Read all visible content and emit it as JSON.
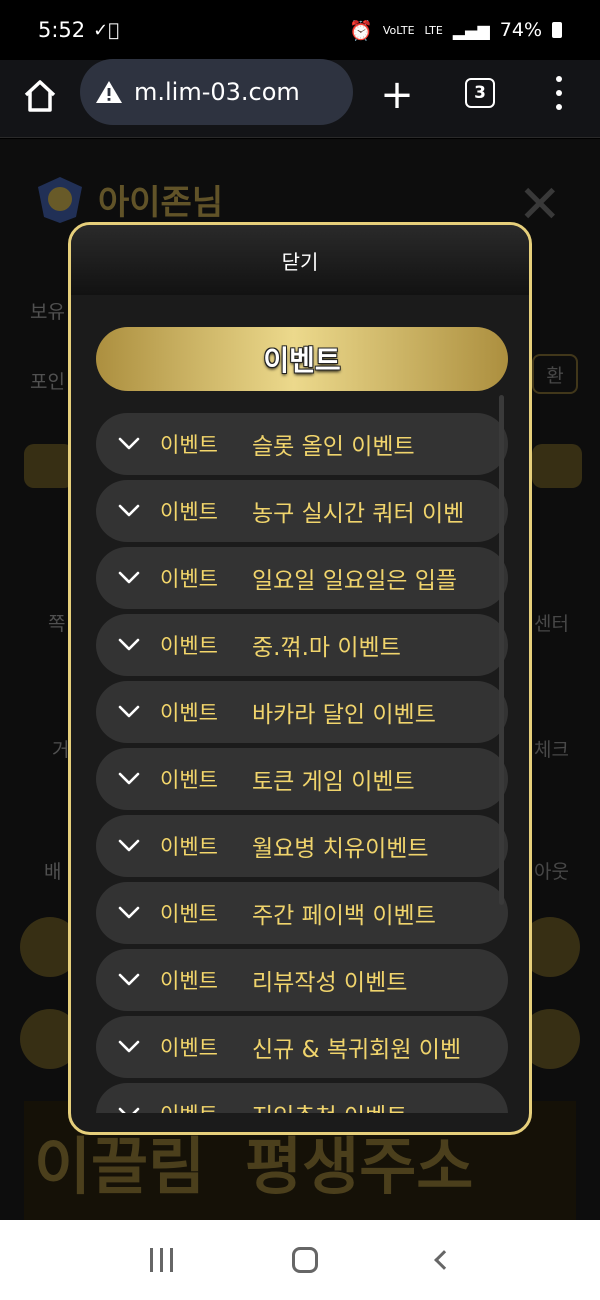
{
  "status_bar": {
    "time": "5:52",
    "battery": "74%"
  },
  "browser": {
    "url": "m.lim-03.com",
    "tab_count": "3"
  },
  "background_page": {
    "title": "아이존님",
    "side_labels_left": [
      "보유",
      "포인"
    ],
    "side_label_right": "환",
    "icon_labels_left": [
      "쪽",
      "거",
      "배"
    ],
    "icon_labels_right": [
      "센터",
      "체크",
      "아웃"
    ],
    "banner_texts": [
      "이끌림",
      "평생주소"
    ]
  },
  "modal": {
    "close_label": "닫기",
    "section_title": "이벤트",
    "events": [
      {
        "tag": "이벤트",
        "title": "슬롯 올인 이벤트"
      },
      {
        "tag": "이벤트",
        "title": "농구 실시간 쿼터 이벤"
      },
      {
        "tag": "이벤트",
        "title": "일요일 일요일은 입플"
      },
      {
        "tag": "이벤트",
        "title": "중.꺾.마 이벤트"
      },
      {
        "tag": "이벤트",
        "title": "바카라 달인 이벤트"
      },
      {
        "tag": "이벤트",
        "title": "토큰 게임 이벤트"
      },
      {
        "tag": "이벤트",
        "title": "월요병 치유이벤트"
      },
      {
        "tag": "이벤트",
        "title": "주간 페이백 이벤트"
      },
      {
        "tag": "이벤트",
        "title": "리뷰작성 이벤트"
      },
      {
        "tag": "이벤트",
        "title": "신규 & 복귀회원 이벤"
      },
      {
        "tag": "이벤트",
        "title": "지인추천 이벤트"
      }
    ]
  },
  "colors": {
    "accent_gold": "#e6cf7b",
    "event_text": "#f4d76b"
  }
}
